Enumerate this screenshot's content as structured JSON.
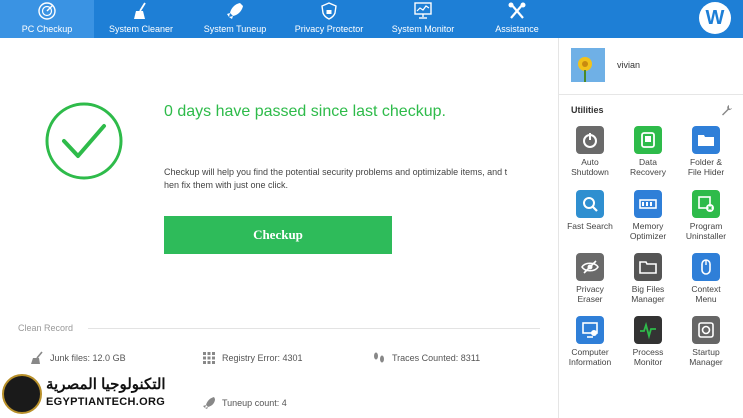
{
  "nav": {
    "items": [
      {
        "label": "PC Checkup",
        "icon": "radar-icon",
        "active": true
      },
      {
        "label": "System Cleaner",
        "icon": "broom-icon",
        "active": false
      },
      {
        "label": "System Tuneup",
        "icon": "rocket-icon",
        "active": false
      },
      {
        "label": "Privacy Protector",
        "icon": "shield-lock-icon",
        "active": false
      },
      {
        "label": "System Monitor",
        "icon": "monitor-chart-icon",
        "active": false
      },
      {
        "label": "Assistance",
        "icon": "tools-icon",
        "active": false
      }
    ],
    "avatar_letter": "W"
  },
  "main": {
    "headline": "0 days have passed since last checkup.",
    "description": "Checkup will help you find the potential security problems and optimizable items, and t hen fix them with just one click.",
    "checkup_button": "Checkup",
    "clean_record_label": "Clean Record",
    "stats": [
      {
        "label": "Junk files:",
        "value": "12.0 GB",
        "icon": "broom-icon"
      },
      {
        "label": "Registry Error:",
        "value": "4301",
        "icon": "grid-icon"
      },
      {
        "label": "Traces Counted:",
        "value": "8311",
        "icon": "footprints-icon"
      },
      {
        "label": "Tuneup count:",
        "value": "4",
        "icon": "rocket-icon"
      }
    ]
  },
  "side": {
    "username": "vivian",
    "utilities_title": "Utilities",
    "utilities": [
      {
        "label": "Auto Shutdown",
        "line1": "Auto",
        "line2": "Shutdown",
        "icon": "power-icon",
        "color": "#6a6a6a"
      },
      {
        "label": "Data Recovery",
        "line1": "Data",
        "line2": "Recovery",
        "icon": "recovery-icon",
        "color": "#2ebb4a"
      },
      {
        "label": "Folder & File Hider",
        "line1": "Folder &",
        "line2": "File Hider",
        "icon": "folder-icon",
        "color": "#2f7fd8"
      },
      {
        "label": "Fast Search",
        "line1": "Fast Search",
        "line2": "",
        "icon": "search-icon",
        "color": "#2f8fd0"
      },
      {
        "label": "Memory Optimizer",
        "line1": "Memory",
        "line2": "Optimizer",
        "icon": "memory-icon",
        "color": "#2f7fd8"
      },
      {
        "label": "Program Uninstaller",
        "line1": "Program",
        "line2": "Uninstaller",
        "icon": "uninstall-icon",
        "color": "#2ebb4a"
      },
      {
        "label": "Privacy Eraser",
        "line1": "Privacy",
        "line2": "Eraser",
        "icon": "eye-slash-icon",
        "color": "#6a6a6a"
      },
      {
        "label": "Big Files Manager",
        "line1": "Big Files",
        "line2": "Manager",
        "icon": "folder-dark-icon",
        "color": "#555555"
      },
      {
        "label": "Context Menu",
        "line1": "Context",
        "line2": "Menu",
        "icon": "mouse-icon",
        "color": "#2f7fd8"
      },
      {
        "label": "Computer Information",
        "line1": "Computer",
        "line2": "Information",
        "icon": "computer-info-icon",
        "color": "#2f7fd8"
      },
      {
        "label": "Process Monitor",
        "line1": "Process",
        "line2": "Monitor",
        "icon": "pulse-icon",
        "color": "#333333"
      },
      {
        "label": "Startup Manager",
        "line1": "Startup",
        "line2": "Manager",
        "icon": "startup-icon",
        "color": "#666666"
      }
    ]
  },
  "watermark": {
    "arabic": "التكنولوجيا المصرية",
    "english": "EGYPTIANTECH.ORG"
  }
}
